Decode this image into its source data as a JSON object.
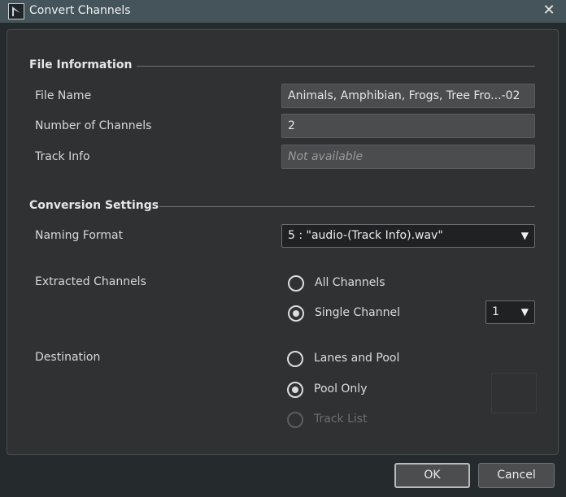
{
  "window": {
    "title": "Convert Channels",
    "close_glyph": "✕"
  },
  "file_info": {
    "heading": "File Information",
    "file_name_label": "File Name",
    "file_name_value": "Animals, Amphibian, Frogs, Tree Fro...-02",
    "channels_label": "Number of Channels",
    "channels_value": "2",
    "track_info_label": "Track Info",
    "track_info_placeholder": "Not available"
  },
  "conversion": {
    "heading": "Conversion Settings",
    "naming_label": "Naming Format",
    "naming_value": "5 : \"audio-(Track Info).wav\"",
    "extracted_label": "Extracted Channels",
    "extracted_options": [
      {
        "label": "All Channels",
        "checked": false,
        "disabled": false
      },
      {
        "label": "Single Channel",
        "checked": true,
        "disabled": false
      }
    ],
    "channel_select_value": "1",
    "destination_label": "Destination",
    "destination_options": [
      {
        "label": "Lanes and Pool",
        "checked": false,
        "disabled": false
      },
      {
        "label": "Pool Only",
        "checked": true,
        "disabled": false
      },
      {
        "label": "Track List",
        "checked": false,
        "disabled": true
      }
    ]
  },
  "buttons": {
    "ok": "OK",
    "cancel": "Cancel"
  },
  "icons": {
    "app": "app-logo-icon",
    "close": "close-icon",
    "dropdown": "chevron-down-icon"
  },
  "colors": {
    "titlebar": "#44545a",
    "panel": "#2f3133",
    "background": "#252a2d"
  }
}
